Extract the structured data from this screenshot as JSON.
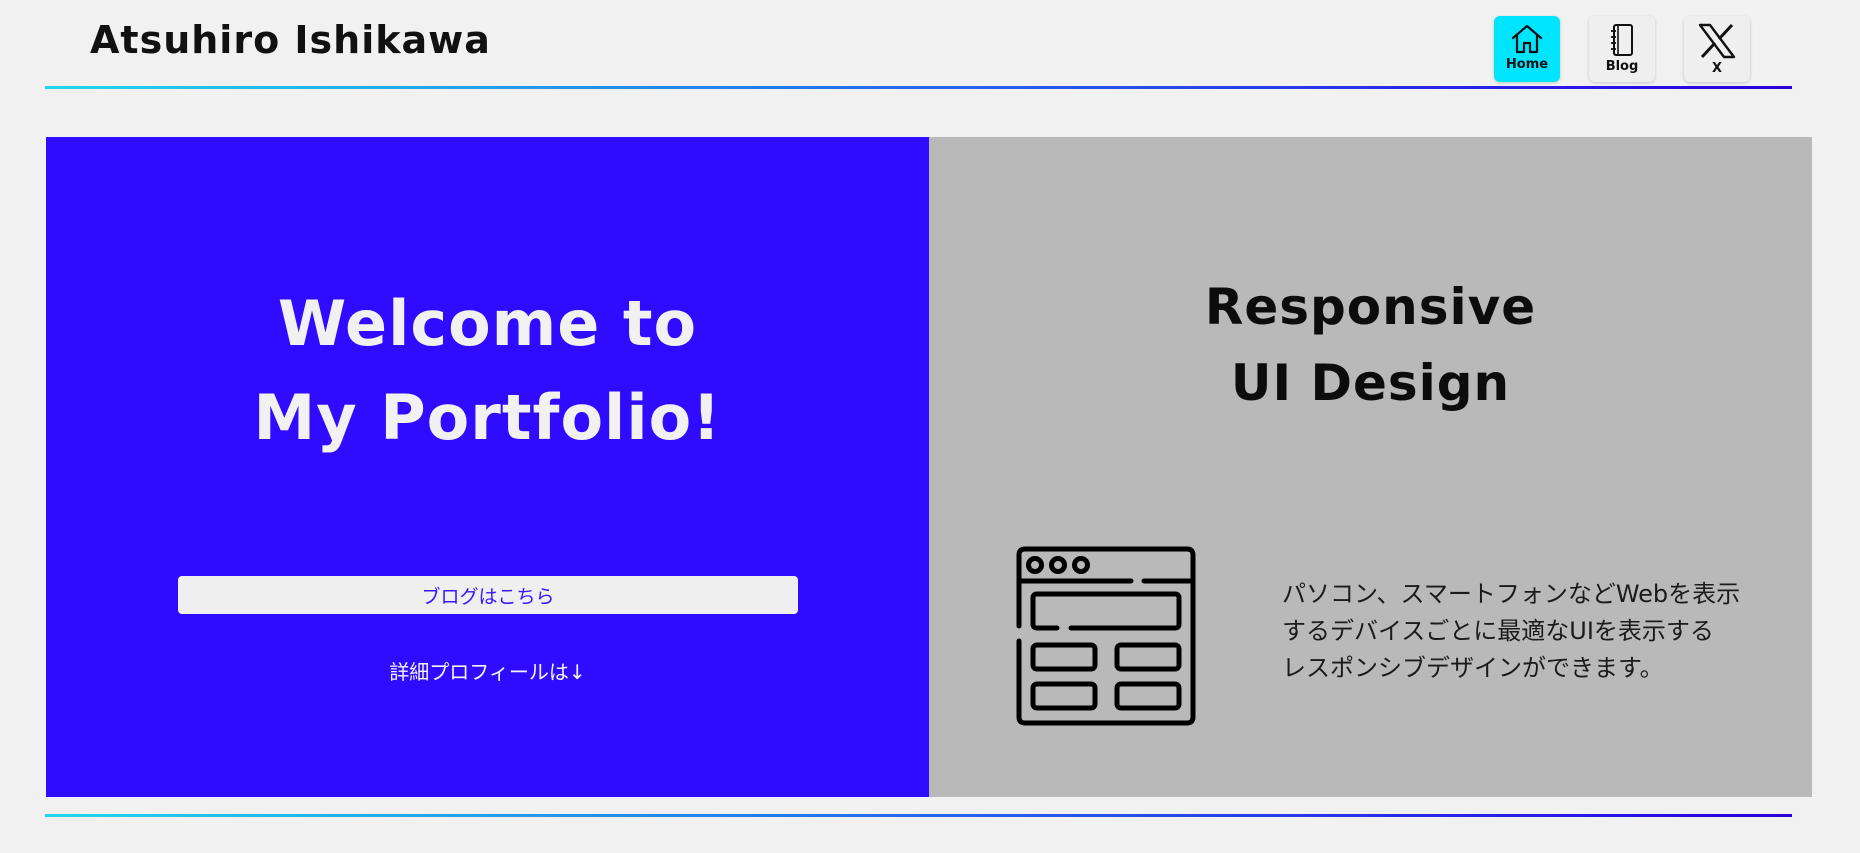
{
  "header": {
    "site_title": "Atsuhiro Ishikawa",
    "nav": [
      {
        "label": "Home",
        "icon": "home-icon",
        "active": true
      },
      {
        "label": "Blog",
        "icon": "notebook-icon",
        "active": false
      },
      {
        "label": "X",
        "icon": "x-logo-icon",
        "active": false
      }
    ]
  },
  "hero": {
    "title_line1": "Welcome to",
    "title_line2": "My Portfolio!",
    "blog_button": "ブログはこちら",
    "profile_link": "詳細プロフィールは↓"
  },
  "feature": {
    "title_line1": "Responsive",
    "title_line2": "UI Design",
    "icon": "browser-window-layout-icon",
    "desc_line1": "パソコン、スマートフォンなどWebを表示",
    "desc_line2": "するデバイスごとに最適なUIを表示する",
    "desc_line3": "レスポンシブデザインができます。"
  },
  "colors": {
    "accent_cyan": "#00e5ff",
    "hero_blue": "#2f0bff",
    "feature_gray": "#b9b9b9",
    "page_bg": "#f1f1f1"
  }
}
